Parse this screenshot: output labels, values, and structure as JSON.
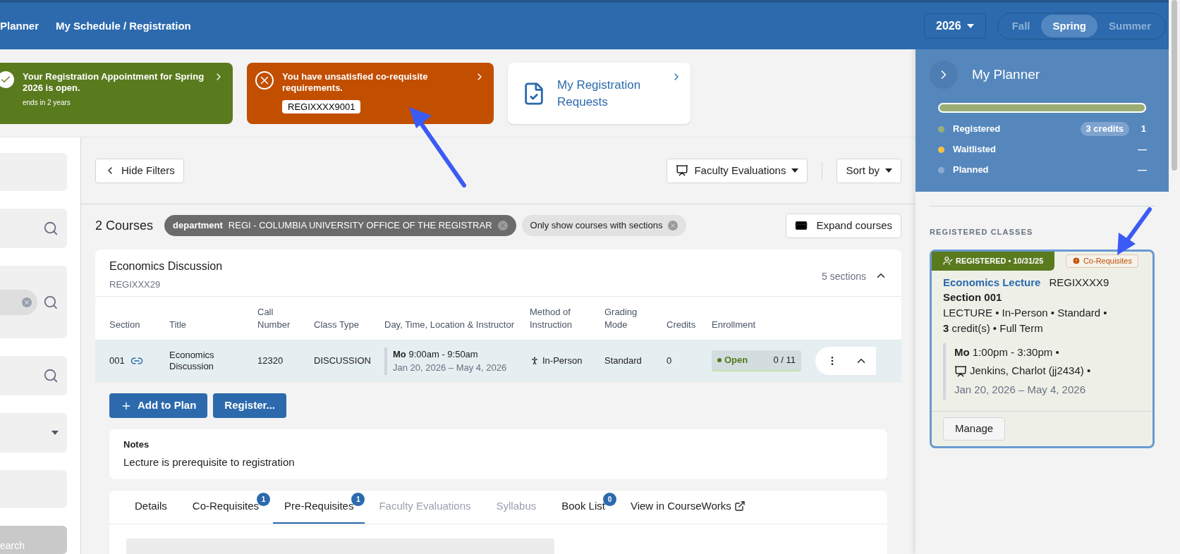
{
  "nav": {
    "items": [
      "Planner",
      "My Schedule / Registration"
    ],
    "year": "2026",
    "terms": [
      {
        "label": "Fall",
        "selected": false
      },
      {
        "label": "Spring",
        "selected": true
      },
      {
        "label": "Summer",
        "selected": false
      }
    ]
  },
  "banners": [
    {
      "kind": "success",
      "text": "Your Registration Appointment for **Spring 2026** is open.",
      "subtext": "ends in 2 years"
    },
    {
      "kind": "error",
      "text": "You have unsatisfied **co-requisite** requirements.",
      "code": "REGIXXXX9001"
    },
    {
      "kind": "link",
      "text": "My Registration Requests"
    }
  ],
  "filters": [
    {
      "kind": "field"
    },
    {
      "kind": "search"
    },
    {
      "kind": "chip-search"
    },
    {
      "kind": "search"
    },
    {
      "kind": "dropdown"
    },
    {
      "kind": "field"
    },
    {
      "kind": "button",
      "label": "earch"
    }
  ],
  "toolbar": {
    "hide_filters": "Hide Filters",
    "faculty_evaluations": "Faculty Evaluations",
    "sort_by": "Sort by"
  },
  "results": {
    "count": "2 Courses",
    "chips": [
      {
        "kind": "dark",
        "key": "department",
        "value": "REGI - COLUMBIA UNIVERSITY OFFICE OF THE REGISTRAR"
      },
      {
        "kind": "light",
        "value": "Only show courses with sections"
      }
    ],
    "expand": "Expand courses"
  },
  "course": {
    "title": "Economics Discussion",
    "code": "REGIXXX29",
    "sections_count": "5 sections",
    "expanded": true,
    "columns": [
      "Section",
      "Title",
      "Call Number",
      "Class Type",
      "Day, Time, Location & Instructor",
      "Method of Instruction",
      "Grading Mode",
      "Credits",
      "Enrollment"
    ],
    "rows": [
      {
        "section": "001",
        "title": "Economics Discussion",
        "call_number": "12320",
        "class_type": "DISCUSSION",
        "day": "Mo",
        "time": "9:00am - 9:50am",
        "dates": "Jan 20, 2026 – May 4, 2026",
        "method": "In-Person",
        "grading": "Standard",
        "credits": "0",
        "status": "Open",
        "seats": "0 / 11",
        "expanded": true
      }
    ],
    "actions": [
      "Add to Plan",
      "Register..."
    ],
    "notes": {
      "title": "Notes",
      "text": "Lecture is prerequisite to registration"
    },
    "tabs": [
      {
        "label": "Details",
        "selected": false,
        "disabled": false
      },
      {
        "label": "Co-Requisites",
        "count": "1",
        "selected": false,
        "disabled": false
      },
      {
        "label": "Pre-Requisites",
        "count": "1",
        "selected": true,
        "disabled": false
      },
      {
        "label": "Faculty Evaluations",
        "selected": false,
        "disabled": true
      },
      {
        "label": "Syllabus",
        "selected": false,
        "disabled": true
      },
      {
        "label": "Book List",
        "count": "0",
        "selected": false,
        "disabled": false
      },
      {
        "label": "View in CourseWorks",
        "external": true,
        "selected": false,
        "disabled": false
      }
    ]
  },
  "planner": {
    "title": "My Planner",
    "level": 1,
    "legend": [
      {
        "label": "Registered",
        "color": "#9aae76",
        "credits": "3 credits",
        "count": "1"
      },
      {
        "label": "Waitlisted",
        "color": "#f5c04a",
        "count": "—"
      },
      {
        "label": "Planned",
        "color": "#8ea9d1",
        "count": "—"
      }
    ],
    "section_label": "REGISTERED CLASSES",
    "classes": [
      {
        "status": "REGISTERED • 10/31/25",
        "warning": "Co-Requisites",
        "title": "Economics Lecture",
        "code": "REGIXXXX9",
        "section": "Section 001",
        "details": "LECTURE • In-Person • Standard •",
        "credits": "3",
        "credits_suffix": "credit(s) • Full Term",
        "day": "Mo",
        "time": "1:00pm - 3:30pm •",
        "instructor": "Jenkins, Charlot (jj2434) •",
        "dates": "Jan 20, 2026 – May 4, 2026",
        "action": "Manage"
      }
    ]
  }
}
